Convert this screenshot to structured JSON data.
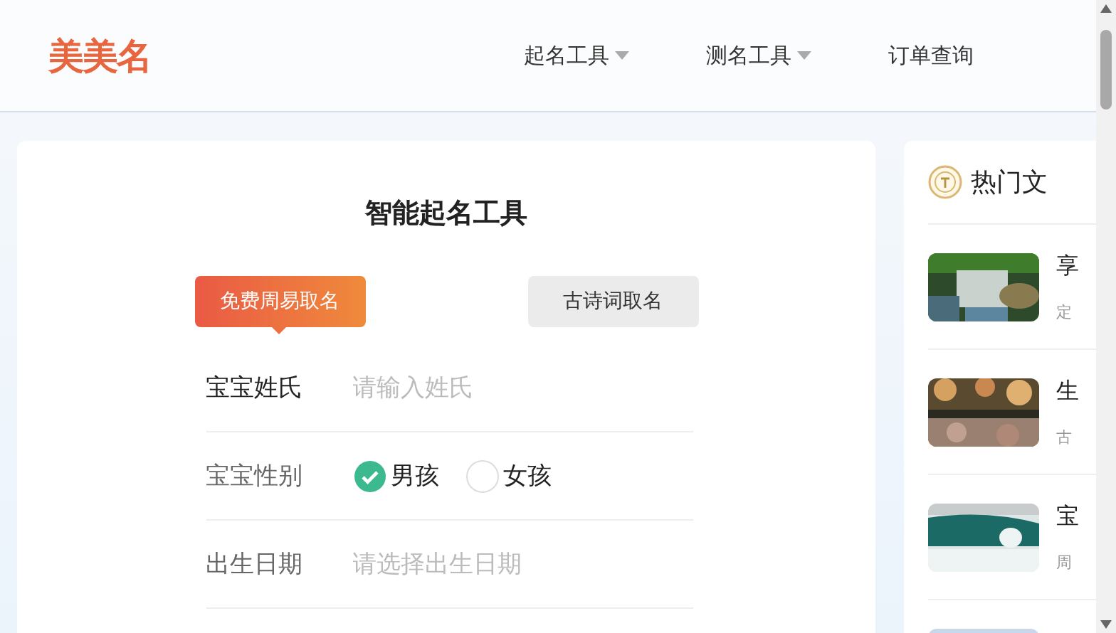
{
  "header": {
    "logo": "美美名",
    "nav": [
      {
        "label": "起名工具",
        "dropdown": true
      },
      {
        "label": "测名工具",
        "dropdown": true
      },
      {
        "label": "订单查询",
        "dropdown": false
      }
    ]
  },
  "form": {
    "title": "智能起名工具",
    "tabs": [
      {
        "label": "免费周易取名",
        "selected": true
      },
      {
        "label": "古诗词取名",
        "selected": false
      }
    ],
    "fields": [
      {
        "kind": "input",
        "label": "宝宝姓氏",
        "placeholder": "请输入姓氏"
      },
      {
        "kind": "radio",
        "label": "宝宝性别",
        "options": [
          {
            "label": "男孩",
            "selected": true
          },
          {
            "label": "女孩",
            "selected": false
          }
        ]
      },
      {
        "kind": "input",
        "label": "出生日期",
        "placeholder": "请选择出生日期"
      }
    ]
  },
  "sidebar": {
    "title": "热门文",
    "articles": [
      {
        "title": "享",
        "meta": "定"
      },
      {
        "title": "生",
        "meta": "古"
      },
      {
        "title": "宝",
        "meta": "周"
      }
    ]
  }
}
